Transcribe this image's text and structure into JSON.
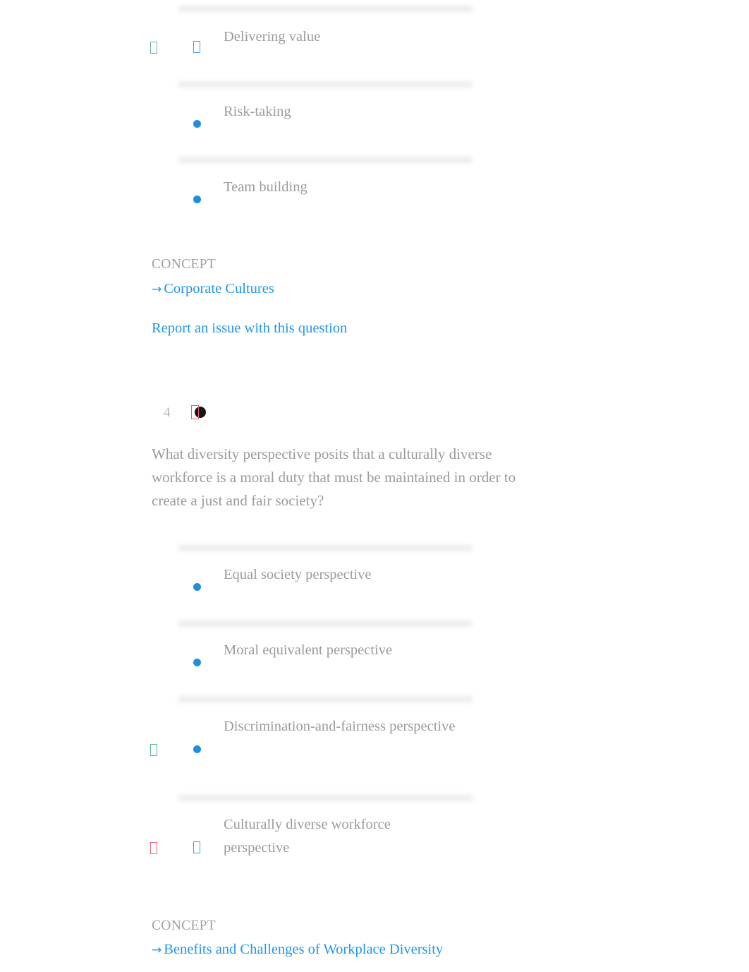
{
  "page": {
    "background": "#ffffff",
    "body_text_color": "#9b9b9b",
    "link_color": "#2196e8",
    "radio_color": "#1f8fdd",
    "correct_marker_color": "#5cb98f",
    "incorrect_marker_color": "#ef6b7e"
  },
  "previous_question": {
    "options": [
      {
        "label": "Delivering value",
        "marker_icon": "correct-answer-check-icon",
        "marker_state": "correct",
        "radio_icon": "selected-radio-icon",
        "radio_state": "tofu-blue"
      },
      {
        "label": "Risk-taking",
        "marker_icon": "none",
        "marker_state": "none",
        "radio_icon": "radio-dot-icon",
        "radio_state": "dot"
      },
      {
        "label": "Team building",
        "marker_icon": "none",
        "marker_state": "none",
        "radio_icon": "radio-dot-icon",
        "radio_state": "dot"
      }
    ],
    "concept_heading": "CONCEPT",
    "concept_arrow": "→",
    "concept_link": "Corporate Cultures",
    "report_link": "Report an issue with this question"
  },
  "question_4": {
    "number": "4",
    "score_icon": "incorrect-score-indicator",
    "text": "What diversity perspective posits that a culturally diverse workforce is a moral duty that must be maintained in order to create a just and fair society?",
    "options": [
      {
        "label": "Equal society perspective",
        "marker_icon": "none",
        "marker_state": "none",
        "radio_icon": "radio-dot-icon",
        "radio_state": "dot"
      },
      {
        "label": "Moral equivalent perspective",
        "marker_icon": "none",
        "marker_state": "none",
        "radio_icon": "radio-dot-icon",
        "radio_state": "dot"
      },
      {
        "label": "Discrimination-and-fairness perspective",
        "marker_icon": "correct-answer-check-icon",
        "marker_state": "correct",
        "radio_icon": "radio-dot-icon",
        "radio_state": "dot"
      },
      {
        "label": "Culturally diverse workforce perspective",
        "marker_icon": "incorrect-answer-cross-icon",
        "marker_state": "incorrect",
        "radio_icon": "selected-radio-icon",
        "radio_state": "tofu-blue"
      }
    ],
    "concept_heading": "CONCEPT",
    "concept_arrow": "→",
    "concept_link": "Benefits and Challenges of Workplace Diversity"
  }
}
